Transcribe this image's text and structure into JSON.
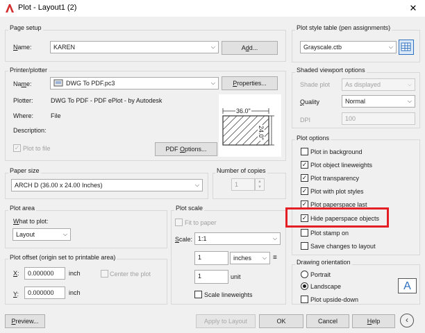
{
  "window": {
    "title": "Plot - Layout1 (2)",
    "close": "✕"
  },
  "page_setup": {
    "title": "Page setup",
    "name_label": "Name:",
    "name_value": "KAREN",
    "add_button": "Add..."
  },
  "printer": {
    "title": "Printer/plotter",
    "name_label": "Name:",
    "name_value": "DWG To PDF.pc3",
    "properties_button": "Properties...",
    "plotter_label": "Plotter:",
    "plotter_value": "DWG To PDF - PDF ePlot - by Autodesk",
    "where_label": "Where:",
    "where_value": "File",
    "description_label": "Description:",
    "plot_to_file": "Plot to file",
    "pdf_options_button": "PDF Options...",
    "preview_width": "36.0\"",
    "preview_height": "24.0\""
  },
  "paper_size": {
    "title": "Paper size",
    "value": "ARCH D (36.00 x 24.00 Inches)"
  },
  "copies": {
    "title": "Number of copies",
    "value": "1"
  },
  "plot_area": {
    "title": "Plot area",
    "what_label": "What to plot:",
    "what_value": "Layout"
  },
  "plot_offset": {
    "title": "Plot offset (origin set to printable area)",
    "x_label": "X:",
    "x_value": "0.000000",
    "x_unit": "inch",
    "y_label": "Y:",
    "y_value": "0.000000",
    "y_unit": "inch",
    "center_label": "Center the plot"
  },
  "plot_scale": {
    "title": "Plot scale",
    "fit_label": "Fit to paper",
    "scale_label": "Scale:",
    "scale_value": "1:1",
    "value1": "1",
    "unit1": "inches",
    "value2": "1",
    "unit2": "unit",
    "scale_lineweights": "Scale lineweights"
  },
  "style_table": {
    "title": "Plot style table (pen assignments)",
    "value": "Grayscale.ctb"
  },
  "shaded": {
    "title": "Shaded viewport options",
    "shade_label": "Shade plot",
    "shade_value": "As displayed",
    "quality_label": "Quality",
    "quality_value": "Normal",
    "dpi_label": "DPI",
    "dpi_value": "100"
  },
  "plot_options": {
    "title": "Plot options",
    "items": [
      {
        "label": "Plot in background",
        "checked": false
      },
      {
        "label": "Plot object lineweights",
        "checked": true
      },
      {
        "label": "Plot transparency",
        "checked": true
      },
      {
        "label": "Plot with plot styles",
        "checked": true
      },
      {
        "label": "Plot paperspace last",
        "checked": true
      },
      {
        "label": "Hide paperspace objects",
        "checked": true
      },
      {
        "label": "Plot stamp on",
        "checked": false
      },
      {
        "label": "Save changes to layout",
        "checked": false
      }
    ]
  },
  "orientation": {
    "title": "Drawing orientation",
    "portrait": "Portrait",
    "landscape": "Landscape",
    "upside_down": "Plot upside-down",
    "selected": "Landscape"
  },
  "footer": {
    "preview": "Preview...",
    "apply": "Apply to Layout",
    "ok": "OK",
    "cancel": "Cancel",
    "help": "Help"
  },
  "colors": {
    "highlight": "#e31e24",
    "app_icon": "#d32f2f",
    "tick": "#1a1a1a"
  },
  "icons": {
    "close": "close-icon",
    "app": "autocad-logo-icon",
    "orientation": "landscape-A-icon",
    "collapse": "chevron-left-icon",
    "edit_style": "edit-plot-style-icon"
  }
}
